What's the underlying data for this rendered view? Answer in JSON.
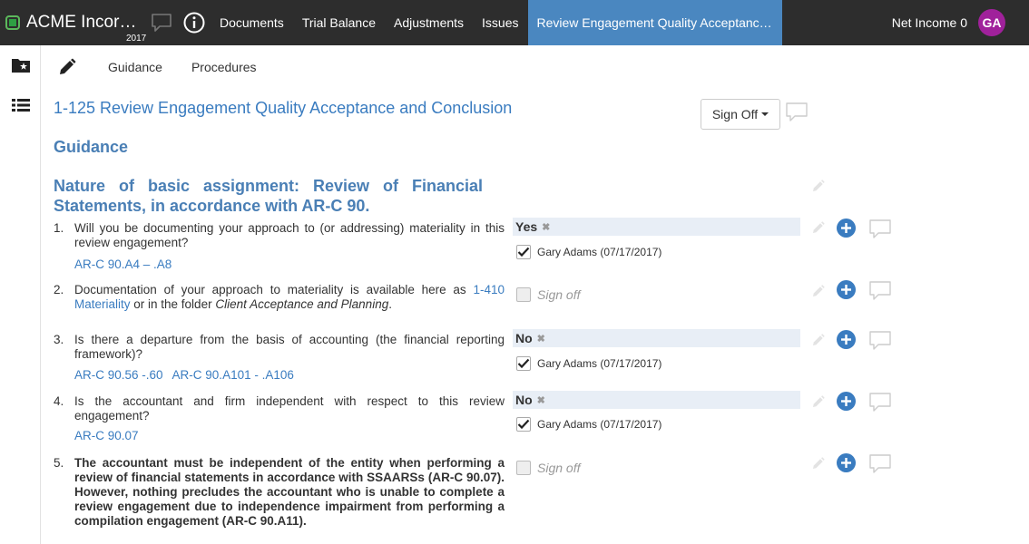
{
  "topbar": {
    "company": "ACME Incor…",
    "year": "2017",
    "nav": [
      "Documents",
      "Trial Balance",
      "Adjustments",
      "Issues"
    ],
    "active_tab": "Review Engagement Quality Acceptanc…",
    "net_income": "Net Income 0",
    "avatar_initials": "GA",
    "avatar_color": "#a0219b",
    "brand_color": "#4a87c0"
  },
  "subbar": {
    "tabs": [
      "Guidance",
      "Procedures"
    ]
  },
  "main": {
    "title": "1-125 Review Engagement Quality Acceptance and Conclusion",
    "signoff_label": "Sign Off",
    "section_heading": "Guidance",
    "nature_heading": "Nature of basic assignment: Review of Financial Statements, in accordance with AR-C 90.",
    "questions": [
      {
        "num": "1.",
        "text": "Will you be documenting your approach to (or addressing) materiality in this review engagement?",
        "refs": [
          "AR-C 90.A4 – .A8"
        ],
        "answer": "Yes",
        "signoff": "Gary Adams (07/17/2017)"
      },
      {
        "num": "2.",
        "text_pre": "Documentation of your approach to materiality is available here as ",
        "text_link": "1-410 Materiality",
        "text_mid": " or in the folder ",
        "text_italic": "Client Acceptance and Planning",
        "text_end": ".",
        "signoff_placeholder": "Sign off"
      },
      {
        "num": "3.",
        "text": "Is there a departure from the basis of accounting (the financial reporting framework)?",
        "refs": [
          "AR-C 90.56 -.60",
          "AR-C 90.A101 - .A106"
        ],
        "answer": "No",
        "signoff": "Gary Adams (07/17/2017)"
      },
      {
        "num": "4.",
        "text": "Is the accountant and firm independent with respect to this review engagement?",
        "refs": [
          "AR-C 90.07"
        ],
        "answer": "No",
        "signoff": "Gary Adams (07/17/2017)"
      },
      {
        "num": "5.",
        "text": "The accountant must be independent of the entity when performing a review of financial statements in accordance with SSAARSs (AR-C 90.07). However, nothing precludes the accountant who is unable to complete a review engagement due to independence impairment from performing a compilation engagement (AR-C 90.A11).",
        "signoff_placeholder": "Sign off"
      }
    ]
  }
}
